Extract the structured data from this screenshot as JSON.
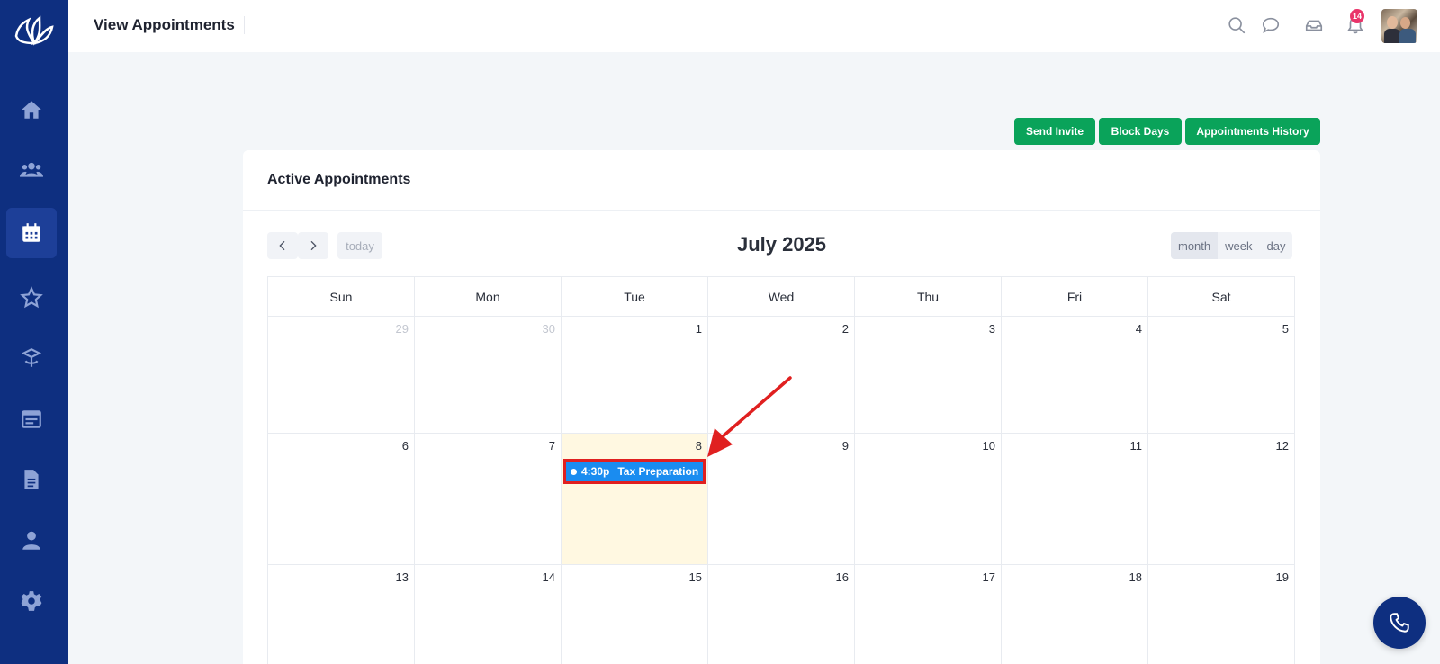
{
  "app": {
    "page_title": "View Appointments"
  },
  "colors": {
    "sidebar": "#0e2f80",
    "primary_green": "#0aa35a",
    "event_blue": "#1a8cf0",
    "today_bg": "#fff8e1",
    "badge": "#e9356a",
    "highlight_red": "#e02020"
  },
  "sidebar": {
    "items": [
      {
        "icon": "home-icon",
        "active": false
      },
      {
        "icon": "users-icon",
        "active": false
      },
      {
        "icon": "calendar-icon",
        "active": true
      },
      {
        "icon": "star-icon",
        "active": false
      },
      {
        "icon": "package-icon",
        "active": false
      },
      {
        "icon": "browser-icon",
        "active": false
      },
      {
        "icon": "document-icon",
        "active": false
      },
      {
        "icon": "user-icon",
        "active": false
      },
      {
        "icon": "gear-icon",
        "active": false
      }
    ]
  },
  "header": {
    "icons": [
      "search-icon",
      "chat-icon",
      "inbox-icon",
      "bell-icon"
    ],
    "notification_count": "14"
  },
  "actions": {
    "send_invite": "Send Invite",
    "block_days": "Block Days",
    "appointments_history": "Appointments History"
  },
  "card": {
    "title": "Active Appointments"
  },
  "calendar": {
    "title": "July 2025",
    "today_label": "today",
    "views": {
      "month": "month",
      "week": "week",
      "day": "day"
    },
    "weekdays": [
      "Sun",
      "Mon",
      "Tue",
      "Wed",
      "Thu",
      "Fri",
      "Sat"
    ],
    "weeks": [
      [
        "29",
        "30",
        "1",
        "2",
        "3",
        "4",
        "5"
      ],
      [
        "6",
        "7",
        "8",
        "9",
        "10",
        "11",
        "12"
      ],
      [
        "13",
        "14",
        "15",
        "16",
        "17",
        "18",
        "19"
      ]
    ],
    "event": {
      "time": "4:30p",
      "title": "Tax Preparation"
    }
  }
}
